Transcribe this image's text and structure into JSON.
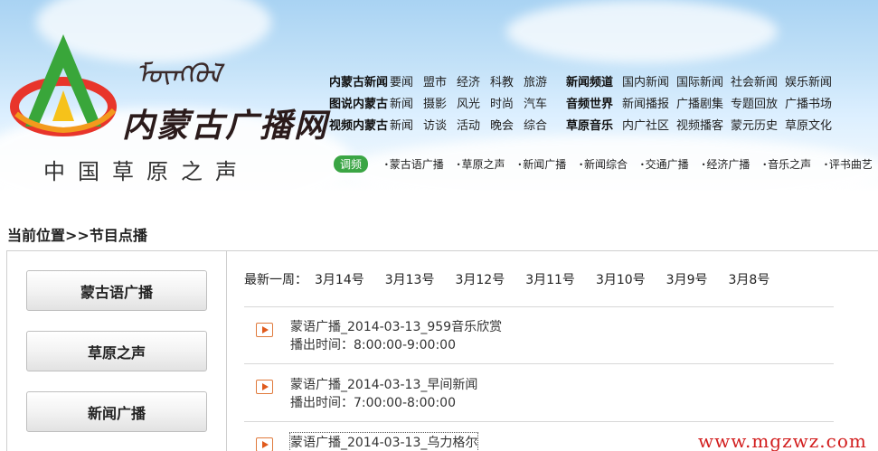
{
  "header": {
    "mongol_script": "ᠮᠦᠩᠭᠦᠯ",
    "site_name": "内蒙古广播网",
    "slogan": "中国草原之声",
    "nav_rows": [
      {
        "cat": "内蒙古新闻",
        "items": [
          "要闻",
          "盟市",
          "经济",
          "科教",
          "旅游"
        ],
        "cat2": "新闻频道",
        "items2": [
          "国内新闻",
          "国际新闻",
          "社会新闻",
          "娱乐新闻"
        ]
      },
      {
        "cat": "图说内蒙古",
        "items": [
          "新闻",
          "摄影",
          "风光",
          "时尚",
          "汽车"
        ],
        "cat2": "音频世界",
        "items2": [
          "新闻播报",
          "广播剧集",
          "专题回放",
          "广播书场"
        ]
      },
      {
        "cat": "视频内蒙古",
        "items": [
          "新闻",
          "访谈",
          "活动",
          "晚会",
          "综合"
        ],
        "cat2": "草原音乐",
        "items2": [
          "内广社区",
          "视频播客",
          "蒙元历史",
          "草原文化"
        ]
      }
    ],
    "tune_label": "调频",
    "channels": [
      "蒙古语广播",
      "草原之声",
      "新闻广播",
      "新闻综合",
      "交通广播",
      "经济广播",
      "音乐之声",
      "评书曲艺"
    ]
  },
  "breadcrumb": "当前位置>>节目点播",
  "sidebar": [
    "蒙古语广播",
    "草原之声",
    "新闻广播"
  ],
  "datebar": {
    "label": "最新一周：",
    "dates": [
      "3月14号",
      "3月13号",
      "3月12号",
      "3月11号",
      "3月10号",
      "3月9号",
      "3月8号"
    ]
  },
  "programs": [
    {
      "title": "蒙语广播_2014-03-13_959音乐欣赏",
      "time": "播出时间：8:00:00-9:00:00"
    },
    {
      "title": "蒙语广播_2014-03-13_早间新闻",
      "time": "播出时间：7:00:00-8:00:00"
    },
    {
      "title": "蒙语广播_2014-03-13_乌力格尔",
      "time": ""
    }
  ],
  "watermark": "www.mgzwz.com",
  "colors": {
    "tune_badge": "#3aa544",
    "play_icon": "#e05a1c",
    "watermark": "#d21d1d"
  }
}
